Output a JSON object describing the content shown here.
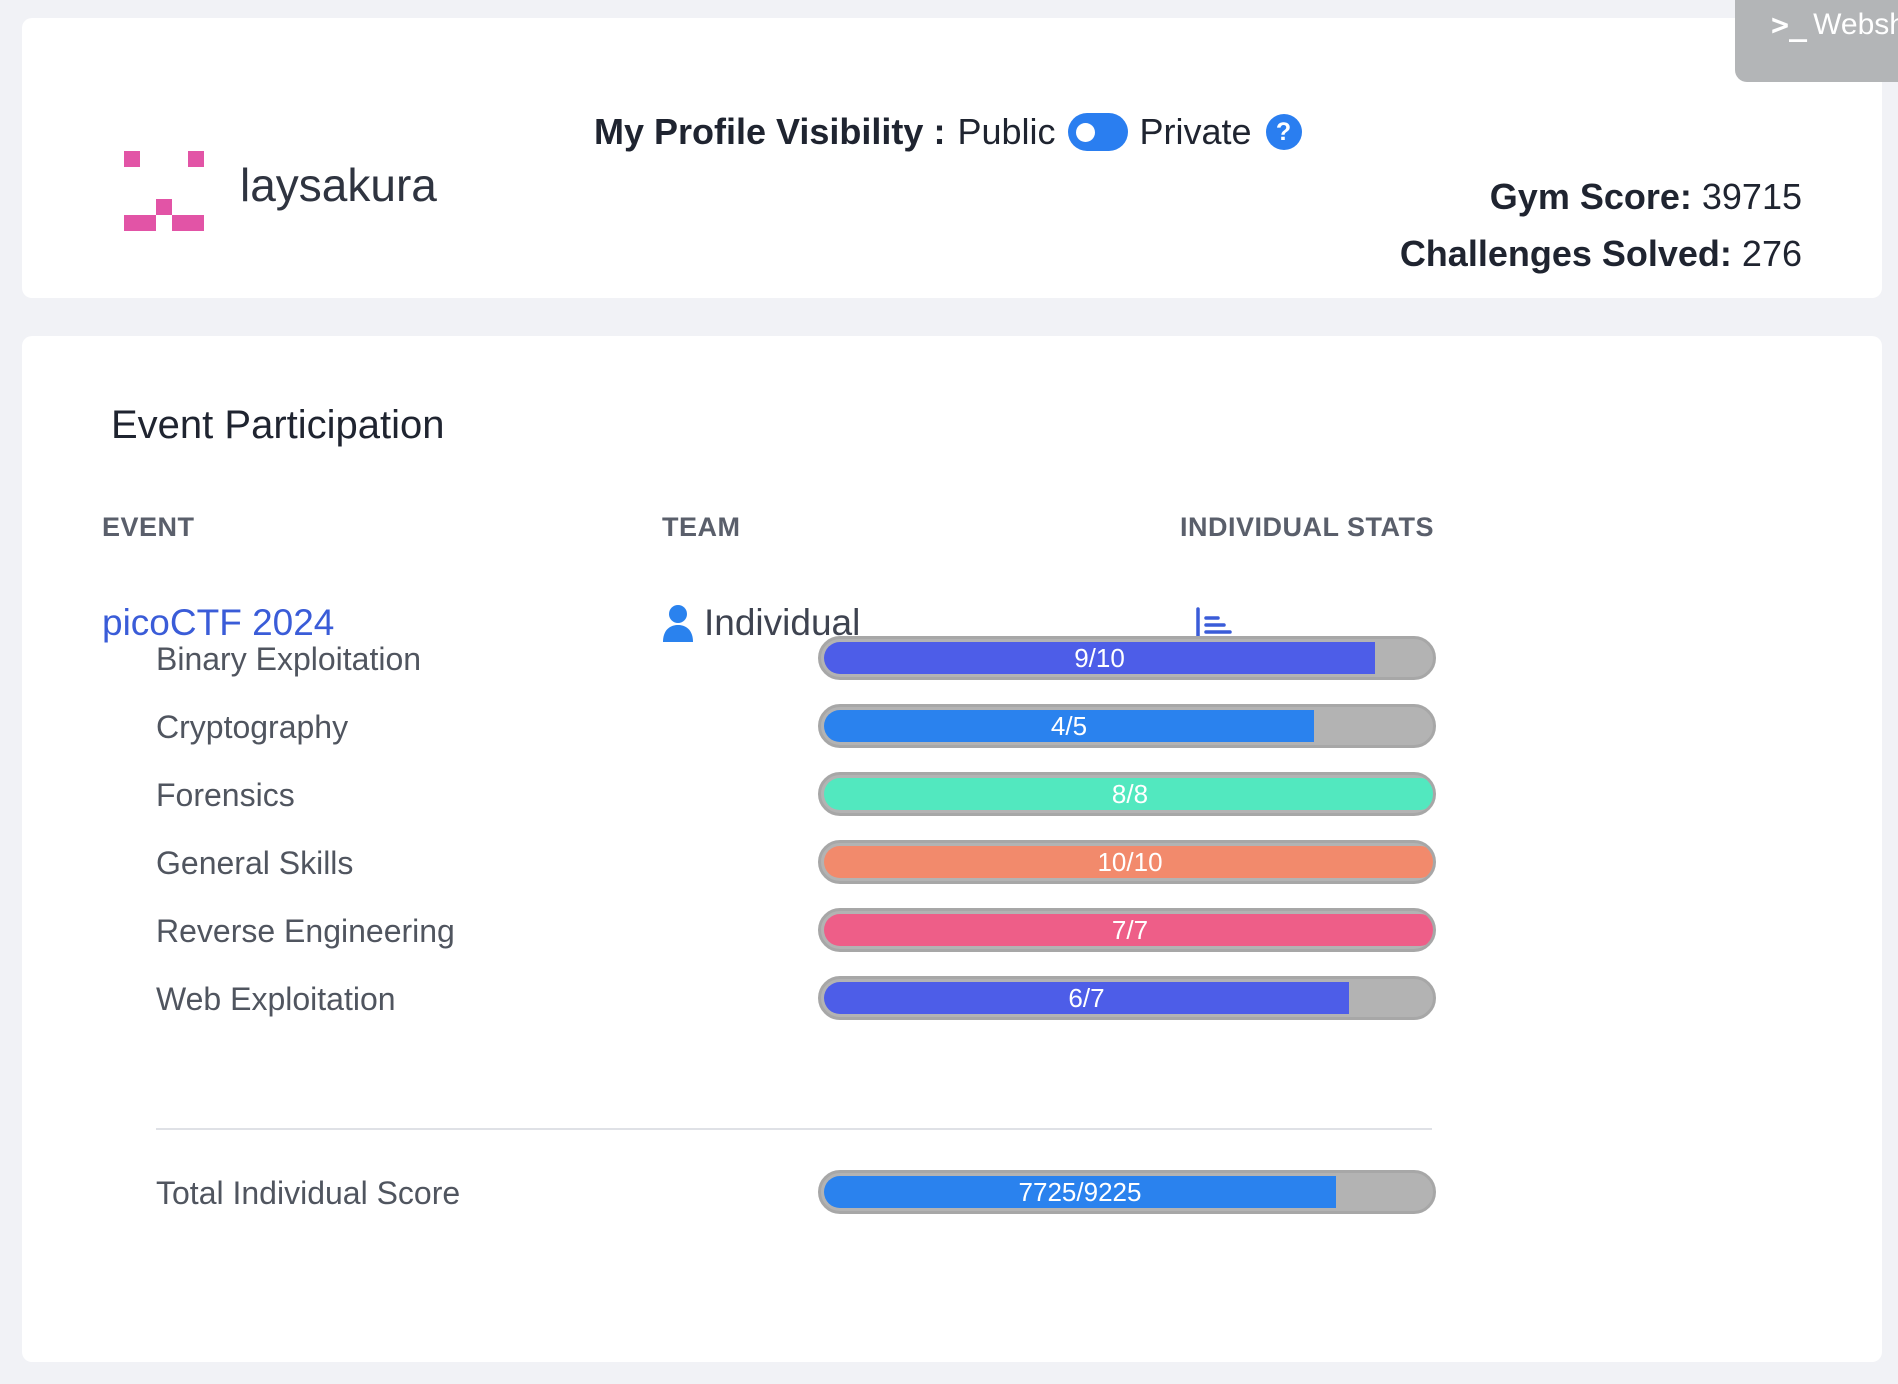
{
  "profile": {
    "username": "laysakura",
    "visibility_label": "My Profile Visibility",
    "visibility_colon": ":",
    "public_label": "Public",
    "private_label": "Private",
    "help_symbol": "?",
    "gym_score_label": "Gym Score:",
    "gym_score_value": "39715",
    "solved_label": "Challenges Solved:",
    "solved_value": "276",
    "toggle_state": "public",
    "avatar_color": "#e254a6"
  },
  "webshell": {
    "label": "Websh"
  },
  "events": {
    "section_title": "Event Participation",
    "columns": [
      "EVENT",
      "TEAM",
      "INDIVIDUAL STATS"
    ],
    "rows": [
      {
        "event": "picoCTF 2024",
        "team": "Individual"
      }
    ]
  },
  "categories": [
    {
      "label": "Binary Exploitation",
      "solved": 9,
      "total": 10,
      "text": "9/10",
      "color": "#4d5de8"
    },
    {
      "label": "Cryptography",
      "solved": 4,
      "total": 5,
      "text": "4/5",
      "color": "#2a82ee"
    },
    {
      "label": "Forensics",
      "solved": 8,
      "total": 8,
      "text": "8/8",
      "color": "#52e8bf"
    },
    {
      "label": "General Skills",
      "solved": 10,
      "total": 10,
      "text": "10/10",
      "color": "#f28a6c"
    },
    {
      "label": "Reverse Engineering",
      "solved": 7,
      "total": 7,
      "text": "7/7",
      "color": "#ee5e88"
    },
    {
      "label": "Web Exploitation",
      "solved": 6,
      "total": 7,
      "text": "6/7",
      "color": "#4d5de8"
    }
  ],
  "total": {
    "label": "Total Individual Score",
    "score": 7725,
    "max": 9225,
    "text": "7725/9225",
    "color": "#2a82ee"
  }
}
